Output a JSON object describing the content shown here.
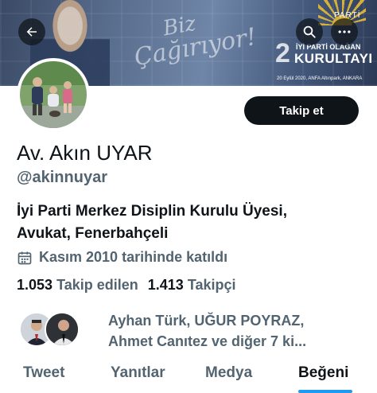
{
  "banner": {
    "script_line1": "Biz",
    "script_line2": "Çağırıyor!",
    "parti_text": "PARTİ",
    "kurultay_number": "2",
    "kurultay_small": "İYİ PARTİ OLAĞAN",
    "kurultay_big": "KURULTAYI",
    "kurultay_date": "20 Eylül 2020, ANFA Altınpark, ANKARA"
  },
  "header_icons": {
    "back": "arrow-left-icon",
    "search": "search-icon",
    "more": "more-horizontal-icon"
  },
  "profile": {
    "name": "Av. Akın UYAR",
    "handle": "@akinnuyar",
    "bio_line1": "İyi Parti Merkez Disiplin Kurulu Üyesi,",
    "bio_line2": "Avukat, Fenerbahçeli",
    "joined": "Kasım 2010 tarihinde katıldı",
    "follow_button": "Takip et"
  },
  "stats": {
    "following_count": "1.053",
    "following_label": "Takip edilen",
    "followers_count": "1.413",
    "followers_label": "Takipçi"
  },
  "known_followers": {
    "line1": "Ayhan Türk, UĞUR POYRAZ,",
    "line2": "Ahmet Canıtez ve diğer 7 ki..."
  },
  "tabs": [
    {
      "label": "Tweet"
    },
    {
      "label": "Yanıtlar"
    },
    {
      "label": "Medya"
    },
    {
      "label": "Beğeni"
    }
  ],
  "colors": {
    "accent": "#1d9bf0",
    "text_primary": "#0f1419",
    "text_secondary": "#536471",
    "button_bg": "#0f1419"
  }
}
